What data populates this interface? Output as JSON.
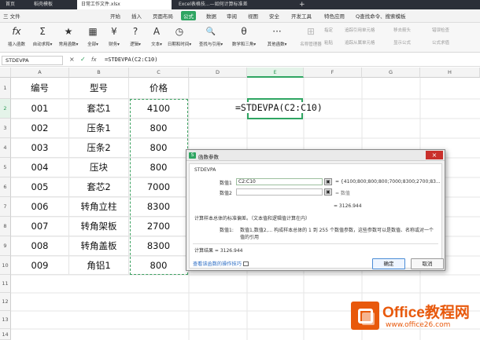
{
  "window": {
    "tabs": [
      {
        "label": "首页",
        "active": false
      },
      {
        "label": "稻壳模板",
        "active": false
      },
      {
        "label": "日常工作文件.xlsx",
        "active": true
      },
      {
        "label": "Excel表格技...—如何计算标准差",
        "active": false
      }
    ],
    "new_tab": "+"
  },
  "menu": {
    "items": [
      "三 文件",
      "开始",
      "插入",
      "页面布局",
      "公式",
      "数据",
      "审阅",
      "视图",
      "安全",
      "开发工具",
      "特色应用"
    ],
    "active": "公式",
    "search": "Q查找命令、搜索模板"
  },
  "ribbon": {
    "buttons": [
      {
        "icon": "fx",
        "label": "插入函数"
      },
      {
        "icon": "Σ",
        "label": "自动求和▾"
      },
      {
        "icon": "★",
        "label": "常用函数▾"
      },
      {
        "icon": "▦",
        "label": "全部▾"
      },
      {
        "icon": "¥",
        "label": "财务▾"
      },
      {
        "icon": "?",
        "label": "逻辑▾"
      },
      {
        "icon": "A",
        "label": "文本▾"
      },
      {
        "icon": "◷",
        "label": "日期和时间▾"
      },
      {
        "icon": "🔍",
        "label": "查找与引用▾"
      },
      {
        "icon": "θ",
        "label": "数学和三角▾"
      },
      {
        "icon": "···",
        "label": "其他函数▾"
      }
    ],
    "grey_items": [
      "名称管理器",
      "指定",
      "粘贴",
      "追踪引用单元格",
      "追踪从属单元格",
      "移去箭头",
      "显示公式",
      "错误检查",
      "公式求值"
    ]
  },
  "formula_bar": {
    "name_box": "STDEVPA",
    "cancel_icon": "×",
    "enter_icon": "✓",
    "fx": "fx",
    "formula": "=STDEVPA(C2:C10)"
  },
  "sheet": {
    "columns": [
      "A",
      "B",
      "C",
      "D",
      "E",
      "F",
      "G",
      "H"
    ],
    "rows": [
      "1",
      "2",
      "3",
      "4",
      "5",
      "6",
      "7",
      "8",
      "9",
      "10",
      "11",
      "12",
      "13",
      "14"
    ],
    "header": [
      "编号",
      "型号",
      "价格"
    ],
    "data": [
      [
        "001",
        "套芯1",
        "4100"
      ],
      [
        "002",
        "压条1",
        "800"
      ],
      [
        "003",
        "压条2",
        "800"
      ],
      [
        "004",
        "压块",
        "800"
      ],
      [
        "005",
        "套芯2",
        "7000"
      ],
      [
        "006",
        "转角立柱",
        "8300"
      ],
      [
        "007",
        "转角架板",
        "2700"
      ],
      [
        "008",
        "转角盖板",
        "8300"
      ],
      [
        "009",
        "角铝1",
        "800"
      ]
    ],
    "active_cell_formula": "=STDEVPA(C2:C10)"
  },
  "dialog": {
    "title": "函数参数",
    "func_name": "STDEVPA",
    "arg1_label": "数值1",
    "arg1_value": "C2:C10",
    "arg1_result": "= {4100;800;800;800;7000;8300;2700;83...",
    "arg2_label": "数值2",
    "arg2_result": "= 数值",
    "total_result": "= 3126.944",
    "description": "计算样本总体的标准偏差。（文本值和逻辑值计算在内）",
    "arg_desc_label": "数值1:",
    "arg_desc": "数值1,数值2,... 构成样本总体的 1 到 255 个数值参数，这些参数可以是数值、名称或对一个",
    "arg_desc2": "值的引用",
    "calc_result": "计算结果 = 3126.944",
    "help_link": "查看该函数的操作技巧",
    "ok": "确定",
    "cancel": "取消",
    "close": "×"
  },
  "watermark": {
    "line1": "Office教程网",
    "line2": "www.office26.com"
  }
}
